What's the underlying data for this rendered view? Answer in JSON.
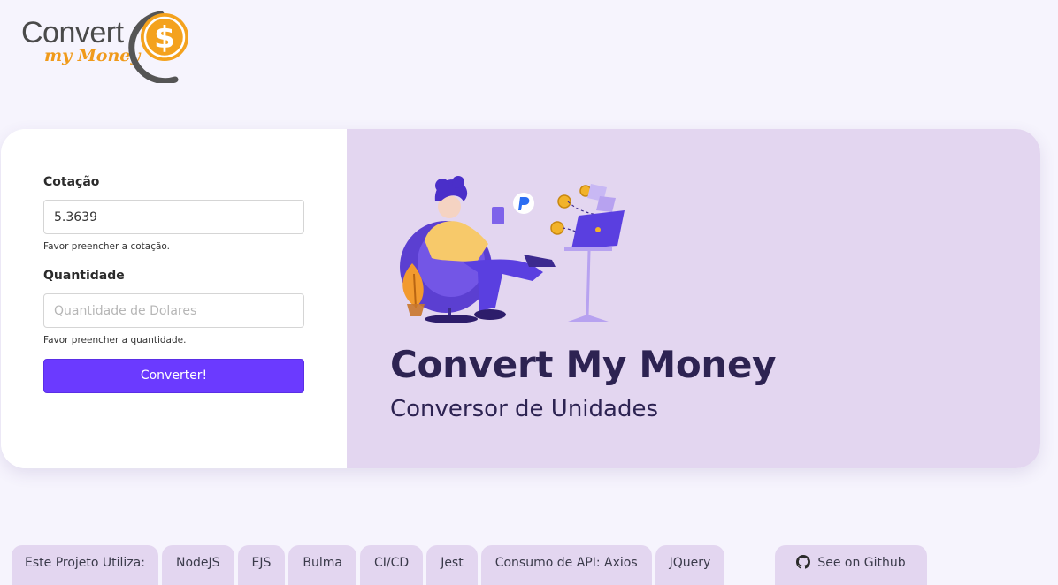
{
  "logo": {
    "word": "Convert",
    "sub": "my Money",
    "symbol": "$"
  },
  "form": {
    "cotacao_label": "Cotação",
    "cotacao_value": "5.3639",
    "cotacao_help": "Favor preencher a cotação.",
    "quantidade_label": "Quantidade",
    "quantidade_placeholder": "Quantidade de Dolares",
    "quantidade_help": "Favor preencher a quantidade.",
    "convert_label": "Converter!"
  },
  "hero": {
    "title": "Convert My Money",
    "subtitle": "Conversor de Unidades"
  },
  "footer": {
    "lead": "Este Projeto Utiliza:",
    "technologies": [
      "NodeJS",
      "EJS",
      "Bulma",
      "CI/CD",
      "Jest",
      "Consumo de API: Axios",
      "JQuery"
    ],
    "github_label": "See on Github",
    "github_icon": "github-icon"
  },
  "colors": {
    "background": "#f6f4fd",
    "hero_background": "#e3d6f0",
    "button": "#6b3aff",
    "title": "#2d2352",
    "logo_orange": "#f09a1a"
  }
}
